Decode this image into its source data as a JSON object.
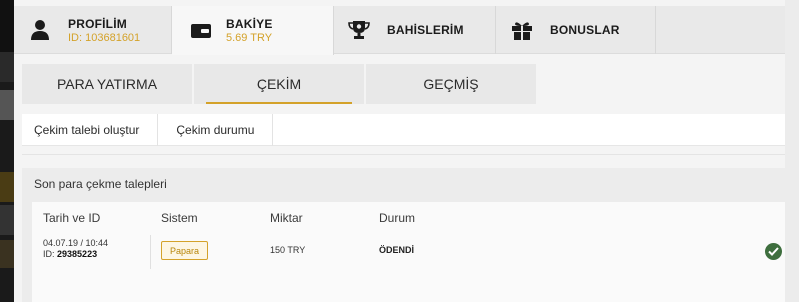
{
  "top_tabs": [
    {
      "label": "PROFİLİM",
      "sub": "ID: 103681601",
      "icon": "user-icon"
    },
    {
      "label": "BAKİYE",
      "sub": "5.69 TRY",
      "icon": "wallet-icon"
    },
    {
      "label": "BAHİSLERİM",
      "sub": "",
      "icon": "trophy-icon"
    },
    {
      "label": "BONUSLAR",
      "sub": "",
      "icon": "gift-icon"
    }
  ],
  "sub_tabs": [
    {
      "label": "PARA YATIRMA"
    },
    {
      "label": "ÇEKİM"
    },
    {
      "label": "GEÇMİŞ"
    }
  ],
  "actions": [
    {
      "label": "Çekim talebi oluştur"
    },
    {
      "label": "Çekim durumu"
    }
  ],
  "requests": {
    "title": "Son para çekme talepleri",
    "columns": [
      "Tarih ve ID",
      "Sistem",
      "Miktar",
      "Durum"
    ],
    "rows": [
      {
        "date": "04.07.19 / 10:44",
        "id_label": "ID:",
        "id": "29385223",
        "system": "Papara",
        "amount": "150 TRY",
        "status": "ÖDENDİ"
      }
    ]
  },
  "colors": {
    "accent": "#d4a22a",
    "success": "#3e6e3e"
  }
}
